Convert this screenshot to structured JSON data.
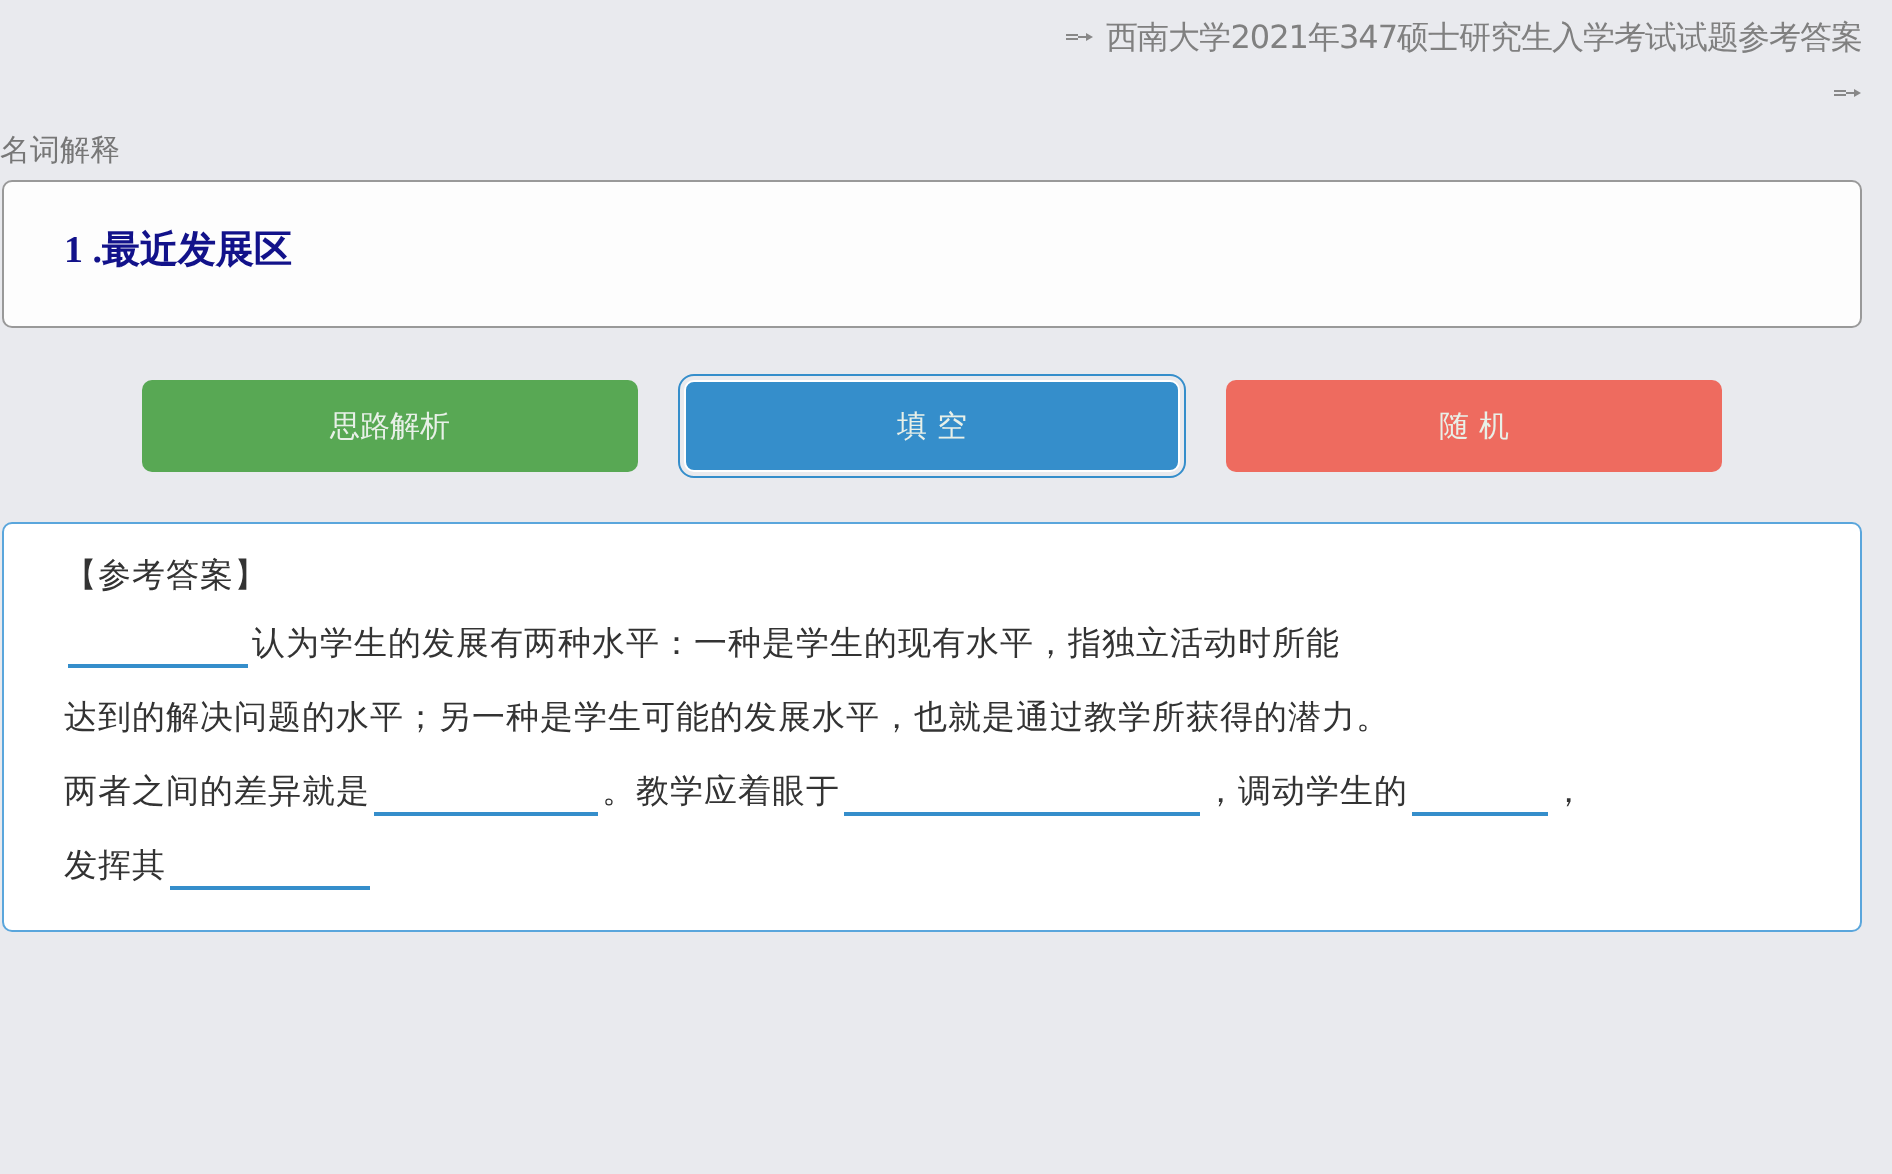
{
  "header": {
    "title": "西南大学2021年347硕士研究生入学考试试题参考答案"
  },
  "section": {
    "label": "名词解释"
  },
  "question": {
    "text": "1 .最近发展区"
  },
  "buttons": [
    {
      "label": "思路解析",
      "color": "#58a854",
      "selected": false
    },
    {
      "label": "填 空",
      "color": "#358ecb",
      "selected": true
    },
    {
      "label": "随 机",
      "color": "#ee6b5f",
      "selected": false
    }
  ],
  "answer": {
    "heading": "【参考答案】",
    "lines": [
      [
        {
          "kind": "blank"
        },
        {
          "kind": "text",
          "text": "认为学生的发展有两种水平：一种是学生的现有水平，指独立活动时所能"
        }
      ],
      [
        {
          "kind": "text",
          "text": "达到的解决问题的水平；另一种是学生可能的发展水平，也就是通过教学所获得的潜力。"
        }
      ],
      [
        {
          "kind": "text",
          "text": "两者之间的差异就是"
        },
        {
          "kind": "blank"
        },
        {
          "kind": "text",
          "text": "。教学应着眼于"
        },
        {
          "kind": "blank"
        },
        {
          "kind": "text",
          "text": "，调动学生的"
        },
        {
          "kind": "blank"
        },
        {
          "kind": "text",
          "text": "，"
        }
      ],
      [
        {
          "kind": "text",
          "text": "发挥其"
        },
        {
          "kind": "blank"
        }
      ]
    ]
  }
}
